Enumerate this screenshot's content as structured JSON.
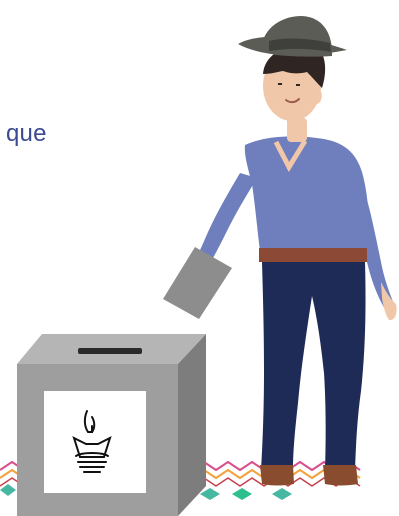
{
  "caption": {
    "text": "que"
  },
  "illustration": {
    "figure": "man-in-hat-icon",
    "ballot": "ballot-paper-icon",
    "box": "ballot-box-icon",
    "emblem": "ship-emblem-icon",
    "border": "zigzag-border-icon"
  },
  "colors": {
    "text": "#3b4a93",
    "shirt": "#6f7fbd",
    "pants": "#1f2b57",
    "hat": "#5b5c55",
    "skin": "#f0c7a8",
    "hair": "#2f2522",
    "belt": "#8c4a36",
    "shoes": "#8a4c2f",
    "box": "#9e9e9e",
    "box_dark": "#7d7d7d",
    "box_light": "#bdbdbd",
    "ballot": "#8d8d8d"
  }
}
